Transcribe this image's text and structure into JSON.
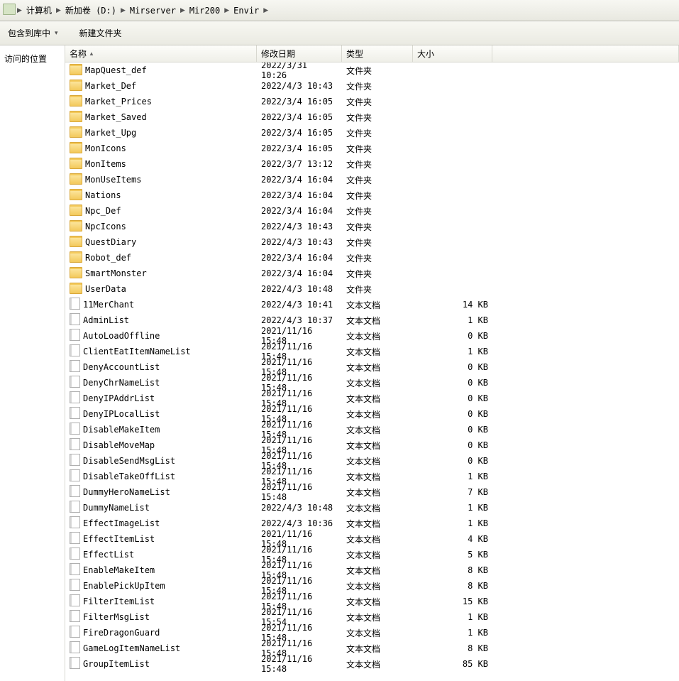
{
  "address": {
    "segs": [
      "计算机",
      "新加卷 (D:)",
      "Mirserver",
      "Mir200",
      "Envir"
    ]
  },
  "toolbar": {
    "include": "包含到库中",
    "newfolder": "新建文件夹"
  },
  "sidebar": {
    "loc": "访问的位置"
  },
  "columns": {
    "name": "名称",
    "date": "修改日期",
    "type": "类型",
    "size": "大小"
  },
  "rows": [
    {
      "icon": "folder",
      "name": "MapQuest_def",
      "date": "2022/3/31 10:26",
      "type": "文件夹",
      "size": ""
    },
    {
      "icon": "folder",
      "name": "Market_Def",
      "date": "2022/4/3 10:43",
      "type": "文件夹",
      "size": ""
    },
    {
      "icon": "folder",
      "name": "Market_Prices",
      "date": "2022/3/4 16:05",
      "type": "文件夹",
      "size": ""
    },
    {
      "icon": "folder",
      "name": "Market_Saved",
      "date": "2022/3/4 16:05",
      "type": "文件夹",
      "size": ""
    },
    {
      "icon": "folder",
      "name": "Market_Upg",
      "date": "2022/3/4 16:05",
      "type": "文件夹",
      "size": ""
    },
    {
      "icon": "folder",
      "name": "MonIcons",
      "date": "2022/3/4 16:05",
      "type": "文件夹",
      "size": ""
    },
    {
      "icon": "folder",
      "name": "MonItems",
      "date": "2022/3/7 13:12",
      "type": "文件夹",
      "size": ""
    },
    {
      "icon": "folder",
      "name": "MonUseItems",
      "date": "2022/3/4 16:04",
      "type": "文件夹",
      "size": ""
    },
    {
      "icon": "folder",
      "name": "Nations",
      "date": "2022/3/4 16:04",
      "type": "文件夹",
      "size": ""
    },
    {
      "icon": "folder",
      "name": "Npc_Def",
      "date": "2022/3/4 16:04",
      "type": "文件夹",
      "size": ""
    },
    {
      "icon": "folder",
      "name": "NpcIcons",
      "date": "2022/4/3 10:43",
      "type": "文件夹",
      "size": ""
    },
    {
      "icon": "folder",
      "name": "QuestDiary",
      "date": "2022/4/3 10:43",
      "type": "文件夹",
      "size": ""
    },
    {
      "icon": "folder",
      "name": "Robot_def",
      "date": "2022/3/4 16:04",
      "type": "文件夹",
      "size": ""
    },
    {
      "icon": "folder",
      "name": "SmartMonster",
      "date": "2022/3/4 16:04",
      "type": "文件夹",
      "size": ""
    },
    {
      "icon": "folder",
      "name": "UserData",
      "date": "2022/4/3 10:48",
      "type": "文件夹",
      "size": ""
    },
    {
      "icon": "file",
      "name": "11MerChant",
      "date": "2022/4/3 10:41",
      "type": "文本文档",
      "size": "14 KB"
    },
    {
      "icon": "file",
      "name": "AdminList",
      "date": "2022/4/3 10:37",
      "type": "文本文档",
      "size": "1 KB"
    },
    {
      "icon": "file",
      "name": "AutoLoadOffline",
      "date": "2021/11/16 15:48",
      "type": "文本文档",
      "size": "0 KB"
    },
    {
      "icon": "file",
      "name": "ClientEatItemNameList",
      "date": "2021/11/16 15:48",
      "type": "文本文档",
      "size": "1 KB"
    },
    {
      "icon": "file",
      "name": "DenyAccountList",
      "date": "2021/11/16 15:48",
      "type": "文本文档",
      "size": "0 KB"
    },
    {
      "icon": "file",
      "name": "DenyChrNameList",
      "date": "2021/11/16 15:48",
      "type": "文本文档",
      "size": "0 KB"
    },
    {
      "icon": "file",
      "name": "DenyIPAddrList",
      "date": "2021/11/16 15:48",
      "type": "文本文档",
      "size": "0 KB"
    },
    {
      "icon": "file",
      "name": "DenyIPLocalList",
      "date": "2021/11/16 15:48",
      "type": "文本文档",
      "size": "0 KB"
    },
    {
      "icon": "file",
      "name": "DisableMakeItem",
      "date": "2021/11/16 15:48",
      "type": "文本文档",
      "size": "0 KB"
    },
    {
      "icon": "file",
      "name": "DisableMoveMap",
      "date": "2021/11/16 15:48",
      "type": "文本文档",
      "size": "0 KB"
    },
    {
      "icon": "file",
      "name": "DisableSendMsgList",
      "date": "2021/11/16 15:48",
      "type": "文本文档",
      "size": "0 KB"
    },
    {
      "icon": "file",
      "name": "DisableTakeOffList",
      "date": "2021/11/16 15:48",
      "type": "文本文档",
      "size": "1 KB"
    },
    {
      "icon": "file",
      "name": "DummyHeroNameList",
      "date": "2021/11/16 15:48",
      "type": "文本文档",
      "size": "7 KB"
    },
    {
      "icon": "file",
      "name": "DummyNameList",
      "date": "2022/4/3 10:48",
      "type": "文本文档",
      "size": "1 KB"
    },
    {
      "icon": "file",
      "name": "EffectImageList",
      "date": "2022/4/3 10:36",
      "type": "文本文档",
      "size": "1 KB"
    },
    {
      "icon": "file",
      "name": "EffectItemList",
      "date": "2021/11/16 15:48",
      "type": "文本文档",
      "size": "4 KB"
    },
    {
      "icon": "file",
      "name": "EffectList",
      "date": "2021/11/16 15:48",
      "type": "文本文档",
      "size": "5 KB"
    },
    {
      "icon": "file",
      "name": "EnableMakeItem",
      "date": "2021/11/16 15:48",
      "type": "文本文档",
      "size": "8 KB"
    },
    {
      "icon": "file",
      "name": "EnablePickUpItem",
      "date": "2021/11/16 15:48",
      "type": "文本文档",
      "size": "8 KB"
    },
    {
      "icon": "file",
      "name": "FilterItemList",
      "date": "2021/11/16 15:48",
      "type": "文本文档",
      "size": "15 KB"
    },
    {
      "icon": "file",
      "name": "FilterMsgList",
      "date": "2021/11/16 15:54",
      "type": "文本文档",
      "size": "1 KB"
    },
    {
      "icon": "file",
      "name": "FireDragonGuard",
      "date": "2021/11/16 15:48",
      "type": "文本文档",
      "size": "1 KB"
    },
    {
      "icon": "file",
      "name": "GameLogItemNameList",
      "date": "2021/11/16 15:48",
      "type": "文本文档",
      "size": "8 KB"
    },
    {
      "icon": "file",
      "name": "GroupItemList",
      "date": "2021/11/16 15:48",
      "type": "文本文档",
      "size": "85 KB"
    }
  ]
}
